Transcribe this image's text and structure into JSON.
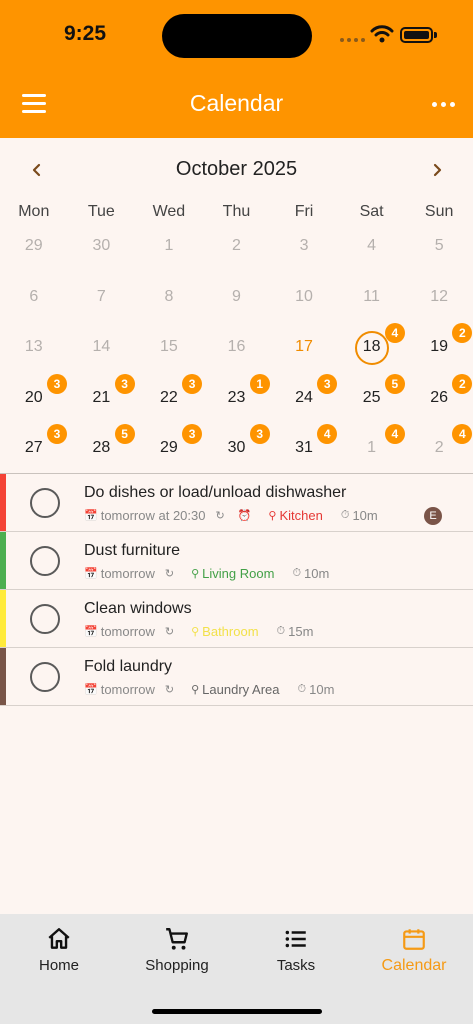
{
  "status_bar": {
    "time": "9:25"
  },
  "header": {
    "title": "Calendar",
    "menu_icon": "hamburger-icon",
    "more_icon": "more-horizontal-icon"
  },
  "calendar": {
    "month_label": "October 2025",
    "weekdays": [
      "Mon",
      "Tue",
      "Wed",
      "Thu",
      "Fri",
      "Sat",
      "Sun"
    ],
    "weeks": [
      [
        {
          "d": "29",
          "dim": true
        },
        {
          "d": "30",
          "dim": true
        },
        {
          "d": "1",
          "dim": true
        },
        {
          "d": "2",
          "dim": true
        },
        {
          "d": "3",
          "dim": true
        },
        {
          "d": "4",
          "dim": true
        },
        {
          "d": "5",
          "dim": true
        }
      ],
      [
        {
          "d": "6",
          "dim": true
        },
        {
          "d": "7",
          "dim": true
        },
        {
          "d": "8",
          "dim": true
        },
        {
          "d": "9",
          "dim": true
        },
        {
          "d": "10",
          "dim": true
        },
        {
          "d": "11",
          "dim": true
        },
        {
          "d": "12",
          "dim": true
        }
      ],
      [
        {
          "d": "13",
          "dim": true
        },
        {
          "d": "14",
          "dim": true
        },
        {
          "d": "15",
          "dim": true
        },
        {
          "d": "16",
          "dim": true
        },
        {
          "d": "17",
          "today": true
        },
        {
          "d": "18",
          "selected": true,
          "badge": "4"
        },
        {
          "d": "19",
          "badge": "2"
        }
      ],
      [
        {
          "d": "20",
          "badge": "3"
        },
        {
          "d": "21",
          "badge": "3"
        },
        {
          "d": "22",
          "badge": "3"
        },
        {
          "d": "23",
          "badge": "1"
        },
        {
          "d": "24",
          "badge": "3"
        },
        {
          "d": "25",
          "badge": "5"
        },
        {
          "d": "26",
          "badge": "2"
        }
      ],
      [
        {
          "d": "27",
          "badge": "3"
        },
        {
          "d": "28",
          "badge": "5"
        },
        {
          "d": "29",
          "badge": "3"
        },
        {
          "d": "30",
          "badge": "3"
        },
        {
          "d": "31",
          "badge": "4"
        },
        {
          "d": "1",
          "dim": true,
          "badge": "4"
        },
        {
          "d": "2",
          "dim": true,
          "badge": "4"
        }
      ]
    ]
  },
  "tasks": [
    {
      "title": "Do dishes or load/unload dishwasher",
      "when": "tomorrow at 20:30",
      "has_alarm": true,
      "location": "Kitchen",
      "location_color": "#e53935",
      "duration": "10m",
      "bar_color": "#f44336",
      "assignee": "E"
    },
    {
      "title": "Dust furniture",
      "when": "tomorrow",
      "has_alarm": false,
      "location": "Living Room",
      "location_color": "#43a047",
      "duration": "10m",
      "bar_color": "#4caf50"
    },
    {
      "title": "Clean windows",
      "when": "tomorrow",
      "has_alarm": false,
      "location": "Bathroom",
      "location_color": "#f2e14a",
      "duration": "15m",
      "bar_color": "#ffeb3b"
    },
    {
      "title": "Fold laundry",
      "when": "tomorrow",
      "has_alarm": false,
      "location": "Laundry Area",
      "location_color": "#666666",
      "duration": "10m",
      "bar_color": "#795548"
    }
  ],
  "bottom_nav": [
    {
      "label": "Home",
      "icon": "home-icon",
      "active": false
    },
    {
      "label": "Shopping",
      "icon": "cart-icon",
      "active": false
    },
    {
      "label": "Tasks",
      "icon": "list-icon",
      "active": false
    },
    {
      "label": "Calendar",
      "icon": "calendar-icon",
      "active": true
    }
  ],
  "colors": {
    "accent": "#fe9400",
    "background": "#fdf5f1",
    "badge": "#fe9400"
  }
}
